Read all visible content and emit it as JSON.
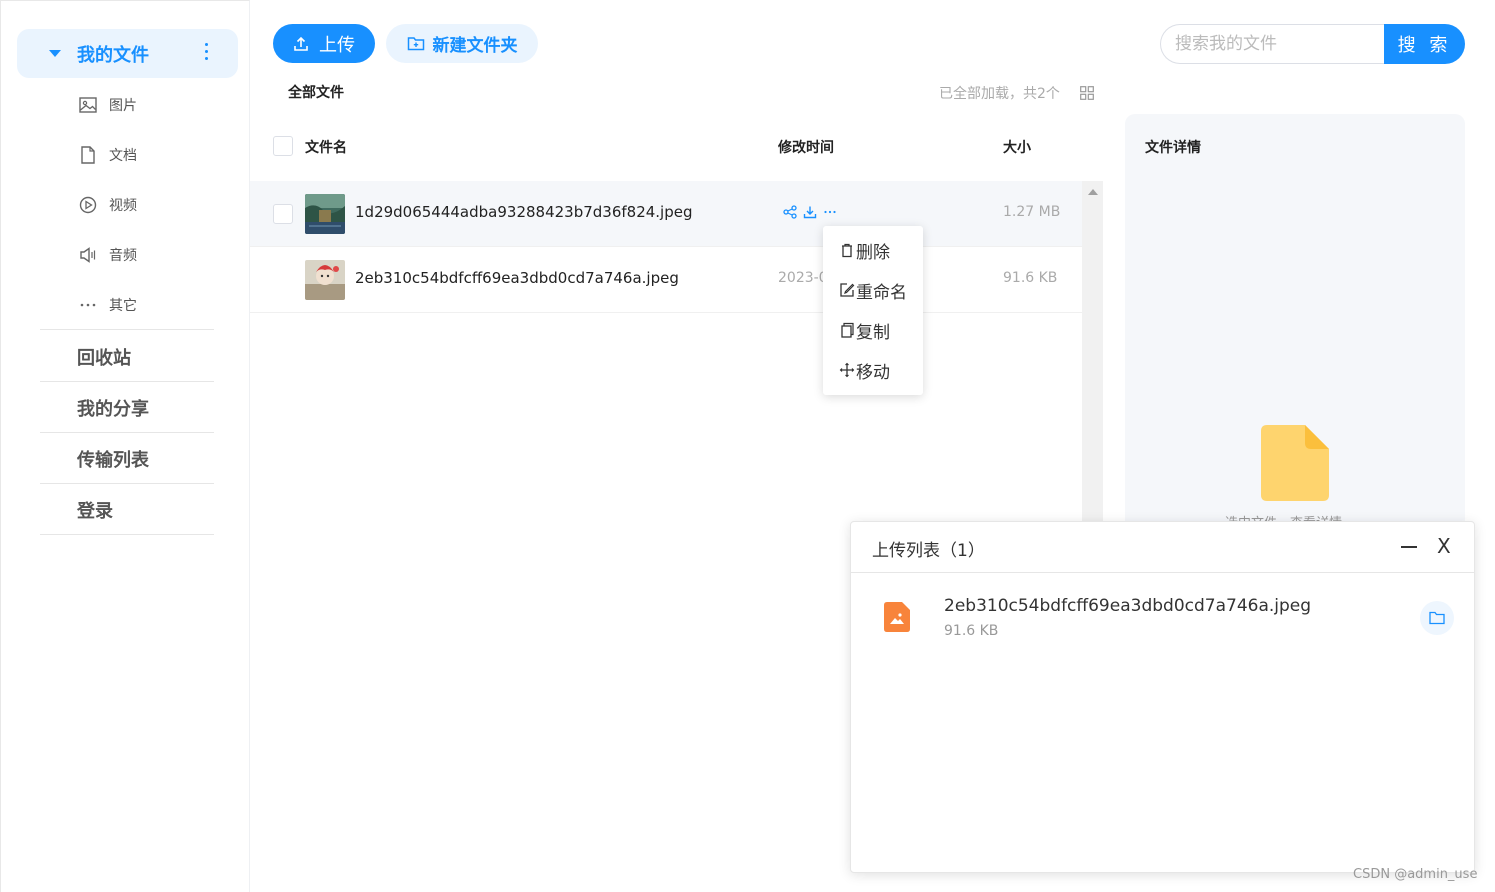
{
  "sidebar": {
    "my_files": "我的文件",
    "sub_items": [
      {
        "label": "图片",
        "icon": "image-icon"
      },
      {
        "label": "文档",
        "icon": "document-icon"
      },
      {
        "label": "视频",
        "icon": "video-icon"
      },
      {
        "label": "音频",
        "icon": "audio-icon"
      },
      {
        "label": "其它",
        "icon": "more-icon"
      }
    ],
    "recycle": "回收站",
    "my_share": "我的分享",
    "transfer_list": "传输列表",
    "login": "登录"
  },
  "toolbar": {
    "upload_label": "上传",
    "new_folder_label": "新建文件夹"
  },
  "search": {
    "placeholder": "搜索我的文件",
    "button_label": "搜 索"
  },
  "breadcrumb": "全部文件",
  "load_status": "已全部加载，共2个",
  "table": {
    "col_name": "文件名",
    "col_modified": "修改时间",
    "col_size": "大小",
    "rows": [
      {
        "name": "1d29d065444adba93288423b7d36f824.jpeg",
        "modified": "",
        "size": "1.27 MB"
      },
      {
        "name": "2eb310c54bdfcff69ea3dbd0cd7a746a.jpeg",
        "modified": "2023-0",
        "size": "91.6 KB"
      }
    ]
  },
  "context_menu": {
    "delete": "删除",
    "rename": "重命名",
    "copy": "复制",
    "move": "移动"
  },
  "detail": {
    "title": "文件详情",
    "hint": "选中文件，查看详情"
  },
  "upload_panel": {
    "title": "上传列表（1）",
    "close_label": "X",
    "item_name": "2eb310c54bdfcff69ea3dbd0cd7a746a.jpeg",
    "item_size": "91.6 KB"
  },
  "watermark": "CSDN @admin_use",
  "colors": {
    "accent": "#1890ff",
    "accent_light": "#eaf4fe",
    "file_icon_orange": "#f8843b",
    "doc_icon_yellow": "#fed46e"
  }
}
